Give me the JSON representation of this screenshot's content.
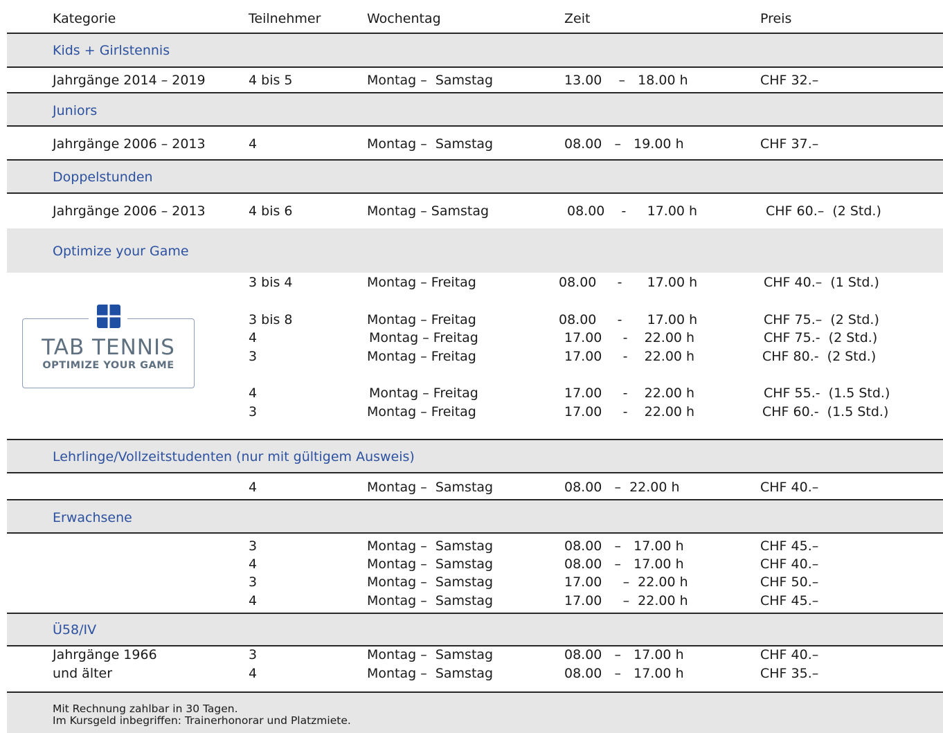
{
  "header": {
    "kategorie": "Kategorie",
    "teilnehmer": "Teilnehmer",
    "wochentag": "Wochentag",
    "zeit": "Zeit",
    "preis": "Preis"
  },
  "sections": {
    "kids": {
      "title": "Kids + Girlstennis",
      "rows": [
        {
          "kategorie": "Jahrgänge 2014 – 2019",
          "teilnehmer": "4 bis 5",
          "wochentag": "Montag –  Samstag",
          "zeit": "13.00    –   18.00 h",
          "preis": "CHF 32.–"
        }
      ]
    },
    "juniors": {
      "title": "Juniors",
      "rows": [
        {
          "kategorie": "Jahrgänge 2006 – 2013",
          "teilnehmer": "4",
          "wochentag": "Montag –  Samstag",
          "zeit": "08.00   –   19.00 h",
          "preis": "CHF 37.–"
        }
      ]
    },
    "doppel": {
      "title": "Doppelstunden",
      "rows": [
        {
          "kategorie": "Jahrgänge 2006 – 2013",
          "teilnehmer": "4 bis 6",
          "wochentag": "Montag – Samstag",
          "zeit": "08.00    -     17.00 h",
          "preis": "CHF 60.–  (2 Std.)"
        }
      ]
    },
    "optimize": {
      "title": "Optimize your Game",
      "logo": {
        "line1": "TAB TENNIS",
        "line2": "OPTIMIZE YOUR GAME"
      },
      "rows": [
        {
          "teilnehmer": "3 bis 4",
          "wochentag": "Montag – Freitag",
          "zeit": "08.00     -      17.00 h",
          "preis": "CHF 40.–  (1 Std.)"
        },
        {
          "teilnehmer": "3 bis 8",
          "wochentag": "Montag – Freitag",
          "zeit": "08.00     -      17.00 h",
          "preis": "CHF 75.–  (2 Std.)"
        },
        {
          "teilnehmer": "4",
          "wochentag": "Montag – Freitag",
          "zeit": "17.00     -    22.00 h",
          "preis": "CHF 75.-  (2 Std.)"
        },
        {
          "teilnehmer": "3",
          "wochentag": "Montag – Freitag",
          "zeit": "17.00     -    22.00 h",
          "preis": "CHF 80.-  (2 Std.)"
        },
        {
          "teilnehmer": "4",
          "wochentag": "Montag – Freitag",
          "zeit": "17.00     -    22.00 h",
          "preis": "CHF 55.-  (1.5 Std.)"
        },
        {
          "teilnehmer": "3",
          "wochentag": "Montag – Freitag",
          "zeit": "17.00     -    22.00 h",
          "preis": "CHF 60.-  (1.5 Std.)"
        }
      ]
    },
    "lehrlinge": {
      "title": "Lehrlinge/Vollzeitstudenten (nur mit gültigem Ausweis)",
      "rows": [
        {
          "teilnehmer": "4",
          "wochentag": "Montag –  Samstag",
          "zeit": "08.00   –  22.00 h",
          "preis": "CHF 40.–"
        }
      ]
    },
    "erwachsene": {
      "title": "Erwachsene",
      "rows": [
        {
          "teilnehmer": "3",
          "wochentag": "Montag –  Samstag",
          "zeit": "08.00   –   17.00 h",
          "preis": "CHF 45.–"
        },
        {
          "teilnehmer": "4",
          "wochentag": "Montag –  Samstag",
          "zeit": "08.00   –   17.00 h",
          "preis": "CHF 40.–"
        },
        {
          "teilnehmer": "3",
          "wochentag": "Montag –  Samstag",
          "zeit": "17.00     –  22.00 h",
          "preis": "CHF 50.–"
        },
        {
          "teilnehmer": "4",
          "wochentag": "Montag –  Samstag",
          "zeit": "17.00     –  22.00 h",
          "preis": "CHF 45.–"
        }
      ]
    },
    "u58": {
      "title": "Ü58/IV",
      "rows": [
        {
          "kategorie": "Jahrgänge 1966",
          "teilnehmer": "3",
          "wochentag": "Montag –  Samstag",
          "zeit": "08.00   –   17.00 h",
          "preis": "CHF 40.–"
        },
        {
          "kategorie": "und älter",
          "teilnehmer": "4",
          "wochentag": "Montag –  Samstag",
          "zeit": "08.00   –   17.00 h",
          "preis": "CHF 35.–"
        }
      ]
    }
  },
  "footer": {
    "line1": "Mit Rechnung zahlbar in 30 Tagen.",
    "line2": "Im Kursgeld inbegriffen: Trainerhonorar und Platzmiete."
  },
  "colors": {
    "category_text": "#2c51a0",
    "band": "#e6e6e6",
    "rule": "#262626",
    "logo": "#5f7080"
  }
}
